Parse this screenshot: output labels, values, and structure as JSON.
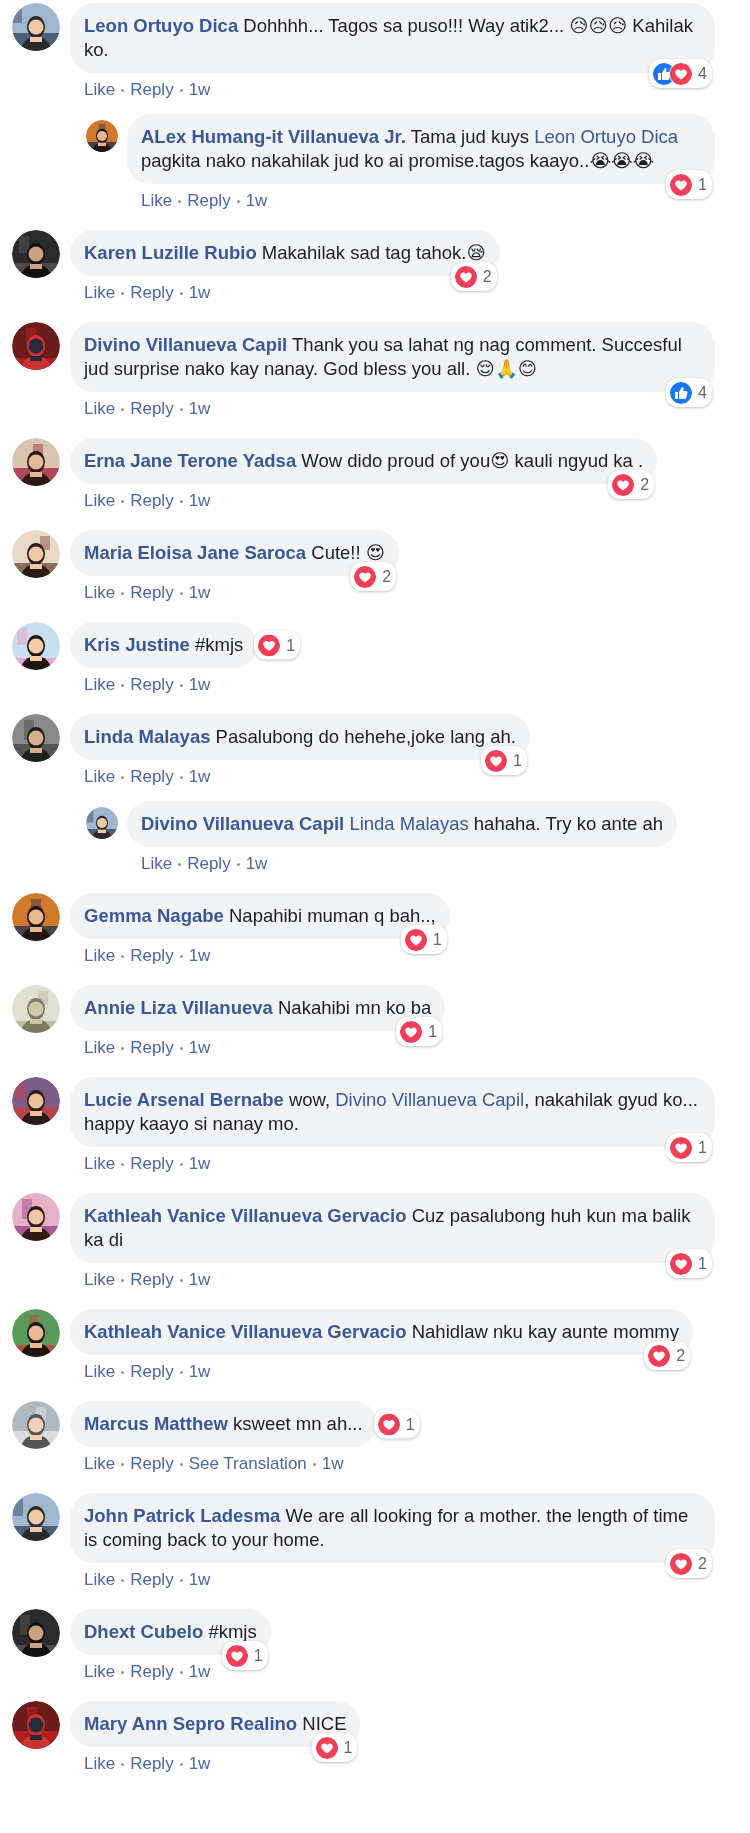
{
  "comments": [
    {
      "author": "Leon Ortuyo Dica",
      "body": [
        {
          "text": "Dohhhh... Tagos sa puso!!! Way atik2... 😥😥😥 Kahilak ko."
        }
      ],
      "actions": [
        "Like",
        "Reply"
      ],
      "time": "1w",
      "reactions": {
        "like": true,
        "love": true,
        "count": "4",
        "side": false
      },
      "replies": [
        {
          "author": "ALex Humang-it Villanueva Jr.",
          "body": [
            {
              "text": "Tama jud kuys "
            },
            {
              "mention": "Leon Ortuyo Dica"
            },
            {
              "text": " pagkita nako nakahilak jud ko ai promise.tagos kaayo..😭😭😭"
            }
          ],
          "actions": [
            "Like",
            "Reply"
          ],
          "time": "1w",
          "reactions": {
            "like": false,
            "love": true,
            "count": "1",
            "side": false
          }
        }
      ]
    },
    {
      "author": "Karen Luzille Rubio",
      "body": [
        {
          "text": "Makahilak sad tag tahok.😪"
        }
      ],
      "actions": [
        "Like",
        "Reply"
      ],
      "time": "1w",
      "reactions": {
        "like": false,
        "love": true,
        "count": "2",
        "side": false
      }
    },
    {
      "author": "Divino Villanueva Capil",
      "body": [
        {
          "text": "Thank you sa lahat ng nag comment. Succesful jud surprise nako kay nanay. God bless you all. 😌🙏😊"
        }
      ],
      "actions": [
        "Like",
        "Reply"
      ],
      "time": "1w",
      "reactions": {
        "like": true,
        "love": false,
        "count": "4",
        "side": false
      }
    },
    {
      "author": "Erna Jane Terone Yadsa",
      "body": [
        {
          "text": "Wow dido proud of you😍 kauli ngyud ka ."
        }
      ],
      "actions": [
        "Like",
        "Reply"
      ],
      "time": "1w",
      "reactions": {
        "like": false,
        "love": true,
        "count": "2",
        "side": false
      }
    },
    {
      "author": "Maria Eloisa Jane Saroca",
      "body": [
        {
          "text": "Cute!! 😍"
        }
      ],
      "actions": [
        "Like",
        "Reply"
      ],
      "time": "1w",
      "reactions": {
        "like": false,
        "love": true,
        "count": "2",
        "side": false
      }
    },
    {
      "author": "Kris Justine",
      "body": [
        {
          "text": "#kmjs"
        }
      ],
      "actions": [
        "Like",
        "Reply"
      ],
      "time": "1w",
      "reactions": {
        "like": false,
        "love": true,
        "count": "1",
        "side": true
      }
    },
    {
      "author": "Linda Malayas",
      "body": [
        {
          "text": "Pasalubong do hehehe,joke lang ah."
        }
      ],
      "actions": [
        "Like",
        "Reply"
      ],
      "time": "1w",
      "reactions": {
        "like": false,
        "love": true,
        "count": "1",
        "side": false
      },
      "replies": [
        {
          "author": "Divino Villanueva Capil",
          "body": [
            {
              "mention": "Linda Malayas"
            },
            {
              "text": " hahaha. Try ko ante ah"
            }
          ],
          "actions": [
            "Like",
            "Reply"
          ],
          "time": "1w"
        }
      ]
    },
    {
      "author": "Gemma Nagabe",
      "body": [
        {
          "text": "Napahibi muman q bah..,"
        }
      ],
      "actions": [
        "Like",
        "Reply"
      ],
      "time": "1w",
      "reactions": {
        "like": false,
        "love": true,
        "count": "1",
        "side": false
      }
    },
    {
      "author": "Annie Liza Villanueva",
      "body": [
        {
          "text": "Nakahibi mn ko ba"
        }
      ],
      "actions": [
        "Like",
        "Reply"
      ],
      "time": "1w",
      "reactions": {
        "like": false,
        "love": true,
        "count": "1",
        "side": false
      }
    },
    {
      "author": "Lucie Arsenal Bernabe",
      "body": [
        {
          "text": "wow, "
        },
        {
          "mention": "Divino Villanueva Capil"
        },
        {
          "text": ", nakahilak gyud ko... happy kaayo si nanay mo."
        }
      ],
      "actions": [
        "Like",
        "Reply"
      ],
      "time": "1w",
      "reactions": {
        "like": false,
        "love": true,
        "count": "1",
        "side": false
      }
    },
    {
      "author": "Kathleah Vanice Villanueva Gervacio",
      "body": [
        {
          "text": "Cuz pasalubong huh kun ma balik ka di"
        }
      ],
      "actions": [
        "Like",
        "Reply"
      ],
      "time": "1w",
      "reactions": {
        "like": false,
        "love": true,
        "count": "1",
        "side": false
      }
    },
    {
      "author": "Kathleah Vanice Villanueva Gervacio",
      "body": [
        {
          "text": "Nahidlaw nku kay aunte mommy"
        }
      ],
      "actions": [
        "Like",
        "Reply"
      ],
      "time": "1w",
      "reactions": {
        "like": false,
        "love": true,
        "count": "2",
        "side": false
      }
    },
    {
      "author": "Marcus Matthew",
      "body": [
        {
          "text": "ksweet mn ah..."
        }
      ],
      "actions": [
        "Like",
        "Reply",
        "See Translation"
      ],
      "time": "1w",
      "reactions": {
        "like": false,
        "love": true,
        "count": "1",
        "side": true
      }
    },
    {
      "author": "John Patrick Ladesma",
      "body": [
        {
          "text": "We are all looking for a mother. the length of time is coming back to your home."
        }
      ],
      "actions": [
        "Like",
        "Reply"
      ],
      "time": "1w",
      "reactions": {
        "like": false,
        "love": true,
        "count": "2",
        "side": false
      }
    },
    {
      "author": "Dhext Cubelo",
      "body": [
        {
          "text": "#kmjs"
        }
      ],
      "actions": [
        "Like",
        "Reply"
      ],
      "time": "1w",
      "reactions": {
        "like": false,
        "love": true,
        "count": "1",
        "side": false
      }
    },
    {
      "author": "Mary Ann Sepro Realino",
      "body": [
        {
          "text": "NICE"
        }
      ],
      "actions": [
        "Like",
        "Reply"
      ],
      "time": "1w",
      "reactions": {
        "like": false,
        "love": true,
        "count": "1",
        "side": false
      }
    }
  ]
}
